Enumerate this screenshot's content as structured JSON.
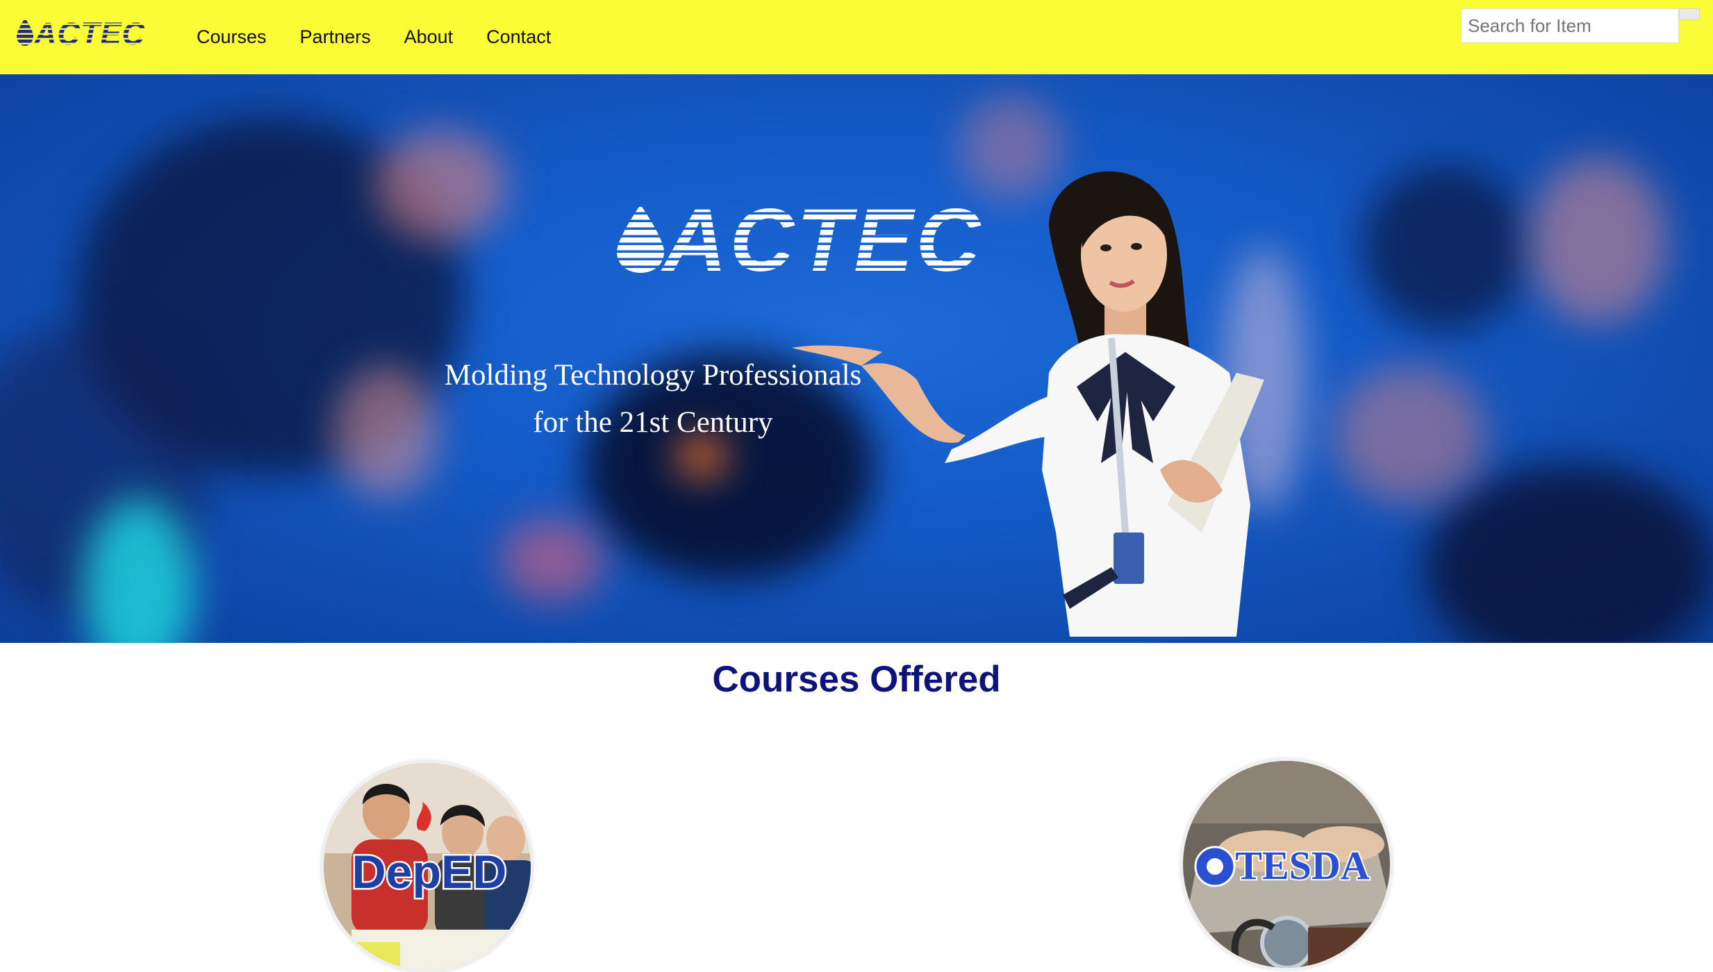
{
  "navbar": {
    "logo_text": "ACTEC",
    "links": [
      {
        "label": "Courses"
      },
      {
        "label": "Partners"
      },
      {
        "label": "About"
      },
      {
        "label": "Contact"
      }
    ],
    "search": {
      "placeholder": "Search for Item",
      "value": ""
    }
  },
  "hero": {
    "logo_text": "ACTEC",
    "tagline_line1": "Molding Technology Professionals",
    "tagline_line2": "for the 21st Century"
  },
  "courses": {
    "title": "Courses Offered",
    "cards": [
      {
        "label": "DepED"
      },
      {
        "label": "TESDA"
      }
    ]
  },
  "colors": {
    "navbar_bg": "#fafc36",
    "brand_navy": "#1a237e",
    "title_navy": "#0d137a",
    "hero_blue": "#1d6ad8"
  }
}
